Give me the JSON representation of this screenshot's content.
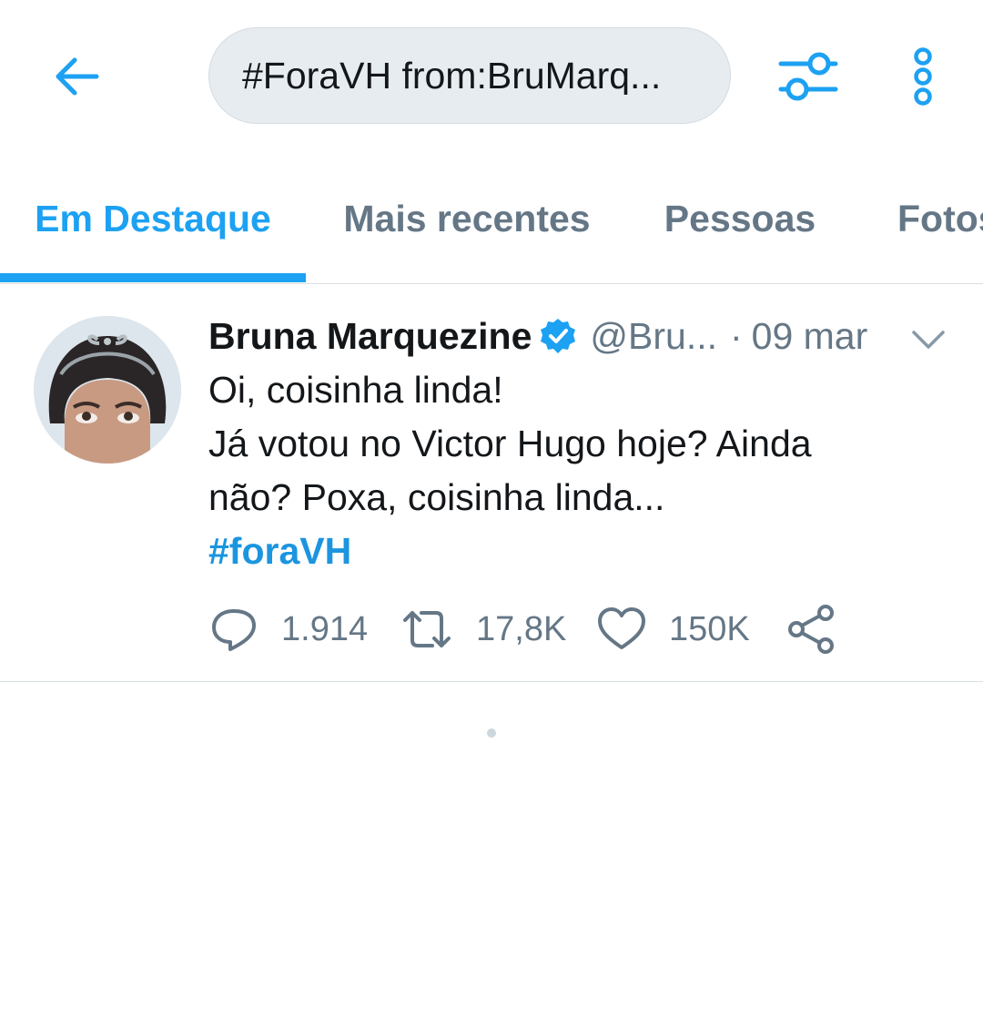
{
  "search": {
    "query": "#ForaVH from:BruMarq..."
  },
  "tabs": [
    {
      "label": "Em Destaque",
      "active": true
    },
    {
      "label": "Mais recentes",
      "active": false
    },
    {
      "label": "Pessoas",
      "active": false
    },
    {
      "label": "Fotos",
      "active": false
    }
  ],
  "tweet": {
    "name": "Bruna Marquezine",
    "handle": "@Bru...",
    "separator": "·",
    "date": "09 mar",
    "text_lines": [
      "Oi, coisinha linda!",
      "Já votou no Victor Hugo hoje? Ainda",
      "não? Poxa, coisinha linda..."
    ],
    "hashtag": "#foraVH",
    "replies": "1.914",
    "retweets": "17,8K",
    "likes": "150K"
  },
  "icons": {
    "back": "arrow-left-icon",
    "filter": "sliders-icon",
    "more": "more-vertical-icon",
    "verified": "verified-badge-icon",
    "caret": "chevron-down-icon",
    "reply": "reply-icon",
    "retweet": "retweet-icon",
    "like": "heart-icon",
    "share": "share-icon"
  },
  "colors": {
    "accent": "#1da1f2",
    "secondary_text": "#657786",
    "search_bg": "#e6ecf0",
    "divider": "#dadfe3"
  }
}
